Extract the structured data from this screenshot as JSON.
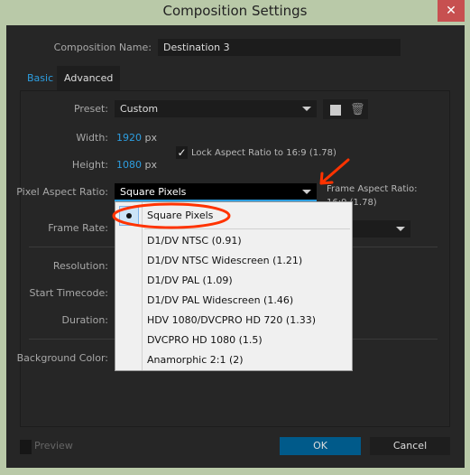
{
  "window": {
    "title": "Composition Settings",
    "close": "✕"
  },
  "comp_name": {
    "label": "Composition Name:",
    "value": "Destination 3"
  },
  "tabs": [
    {
      "label": "Basic",
      "active": true
    },
    {
      "label": "Advanced"
    }
  ],
  "preset": {
    "label": "Preset:",
    "value": "Custom"
  },
  "width": {
    "label": "Width:",
    "value": "1920",
    "unit": "px"
  },
  "height": {
    "label": "Height:",
    "value": "1080",
    "unit": "px"
  },
  "lock": {
    "label": "Lock Aspect Ratio to 16:9 (1.78)",
    "checked": true
  },
  "par": {
    "label": "Pixel Aspect Ratio:",
    "value": "Square Pixels"
  },
  "frame_aspect": {
    "label": "Frame Aspect Ratio:",
    "value": "16:9 (1.78)"
  },
  "labels": {
    "frame_rate": "Frame Rate:",
    "resolution": "Resolution:",
    "start_timecode": "Start Timecode:",
    "duration": "Duration:",
    "background_color": "Background Color:"
  },
  "menu": {
    "selected": "Square Pixels",
    "items": [
      "D1/DV NTSC (0.91)",
      "D1/DV NTSC Widescreen (1.21)",
      "D1/DV PAL (1.09)",
      "D1/DV PAL Widescreen (1.46)",
      "HDV 1080/DVCPRO HD 720 (1.33)",
      "DVCPRO HD 1080 (1.5)",
      "Anamorphic 2:1 (2)"
    ]
  },
  "footer": {
    "preview": "Preview",
    "ok": "OK",
    "cancel": "Cancel"
  },
  "colors": {
    "accent": "#005a8a",
    "annotation": "#ff3300",
    "link": "#2d9ee0"
  }
}
